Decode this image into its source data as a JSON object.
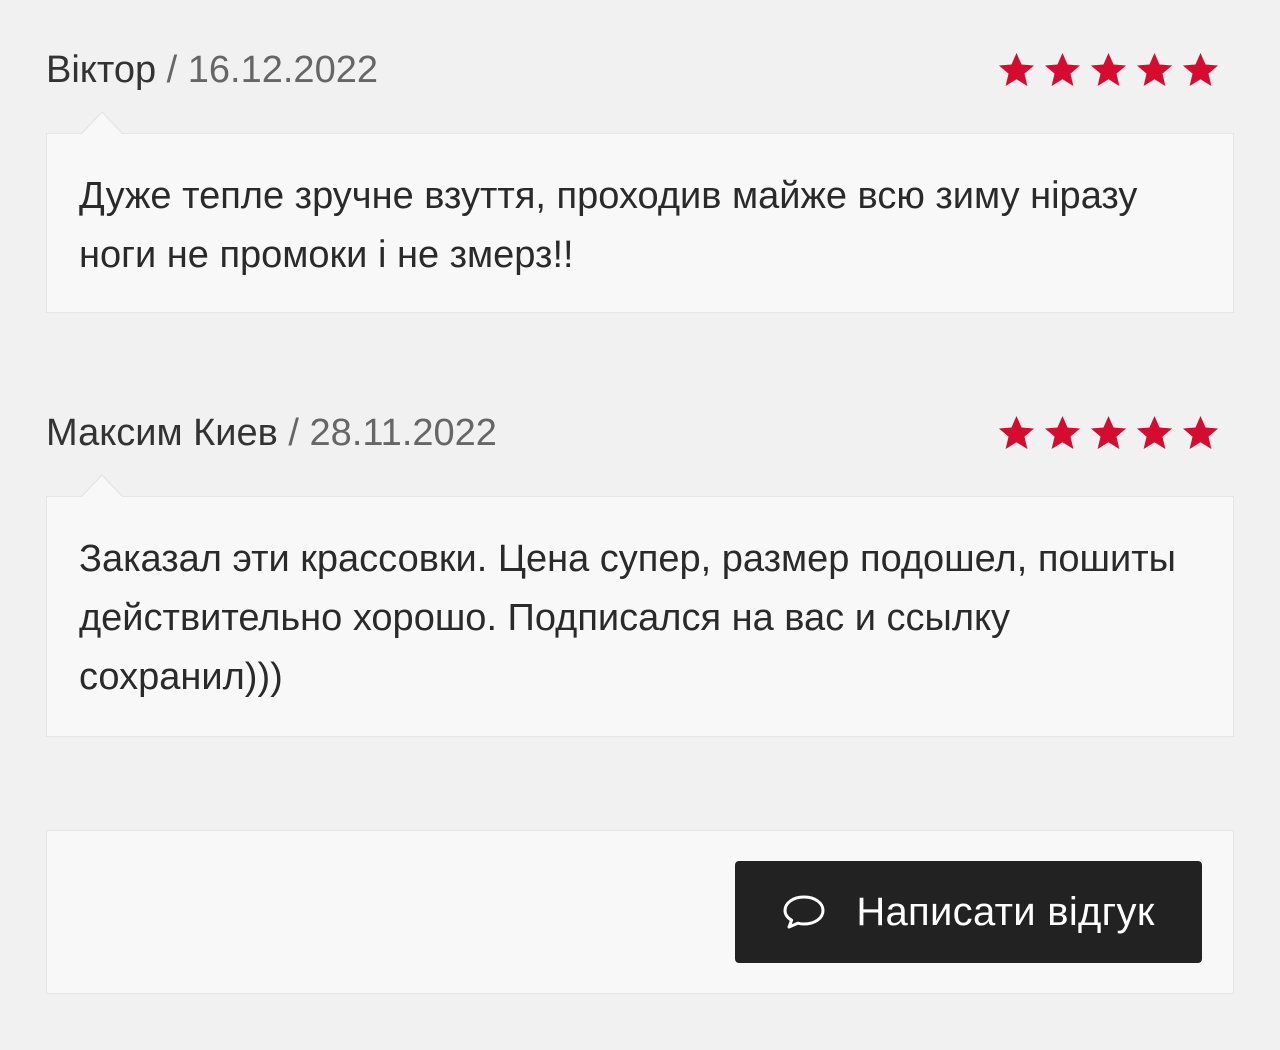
{
  "reviews": [
    {
      "author": "Віктор",
      "separator": "/",
      "date": "16.12.2022",
      "rating": 5,
      "text": "Дуже тепле зручне взуття, проходив майже всю зиму ніразу ноги не промоки і не змерз!!"
    },
    {
      "author": "Максим Киев",
      "separator": "/",
      "date": "28.11.2022",
      "rating": 5,
      "text": "Заказал эти крассовки. Цена супер, размер подошел, пошиты действительно хорошо. Подписался на вас и ссылку сохранил)))"
    }
  ],
  "actions": {
    "write_review_label": "Написати відгук",
    "write_review_icon": "chat-bubble-icon"
  },
  "colors": {
    "background": "#f1f1f1",
    "card": "#f8f8f8",
    "star": "#d50c2f",
    "button": "#222222",
    "button_text": "#ffffff"
  }
}
